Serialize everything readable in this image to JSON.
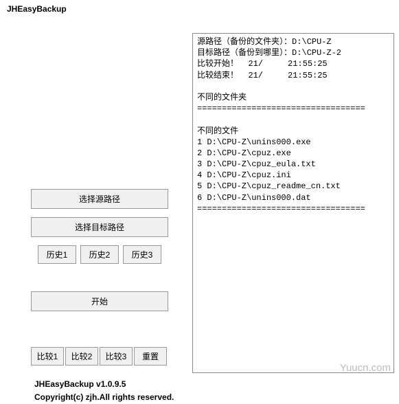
{
  "app_title": "JHEasyBackup",
  "buttons": {
    "select_source": "选择源路径",
    "select_target": "选择目标路径",
    "history1": "历史1",
    "history2": "历史2",
    "history3": "历史3",
    "start": "开始",
    "compare1": "比较1",
    "compare2": "比较2",
    "compare3": "比较3",
    "reset": "重置"
  },
  "info": {
    "version_line": "JHEasyBackup v1.0.9.5",
    "copyright": "Copyright(c) zjh.All rights reserved."
  },
  "log": {
    "line1": "源路径（备份的文件夹）：D:\\CPU-Z",
    "line2": "目标路径（备份到哪里）：D:\\CPU-Z-2",
    "line3": "比较开始！  21/     21:55:25",
    "line4": "比较结束！  21/     21:55:25",
    "blank1": "",
    "diff_folders_header": "不同的文件夹",
    "sep1": "==================================",
    "blank2": "",
    "diff_files_header": "不同的文件",
    "file1": "1 D:\\CPU-Z\\unins000.exe",
    "file2": "2 D:\\CPU-Z\\cpuz.exe",
    "file3": "3 D:\\CPU-Z\\cpuz_eula.txt",
    "file4": "4 D:\\CPU-Z\\cpuz.ini",
    "file5": "5 D:\\CPU-Z\\cpuz_readme_cn.txt",
    "file6": "6 D:\\CPU-Z\\unins000.dat",
    "sep2": "=================================="
  },
  "watermark": "Yuucn.com"
}
